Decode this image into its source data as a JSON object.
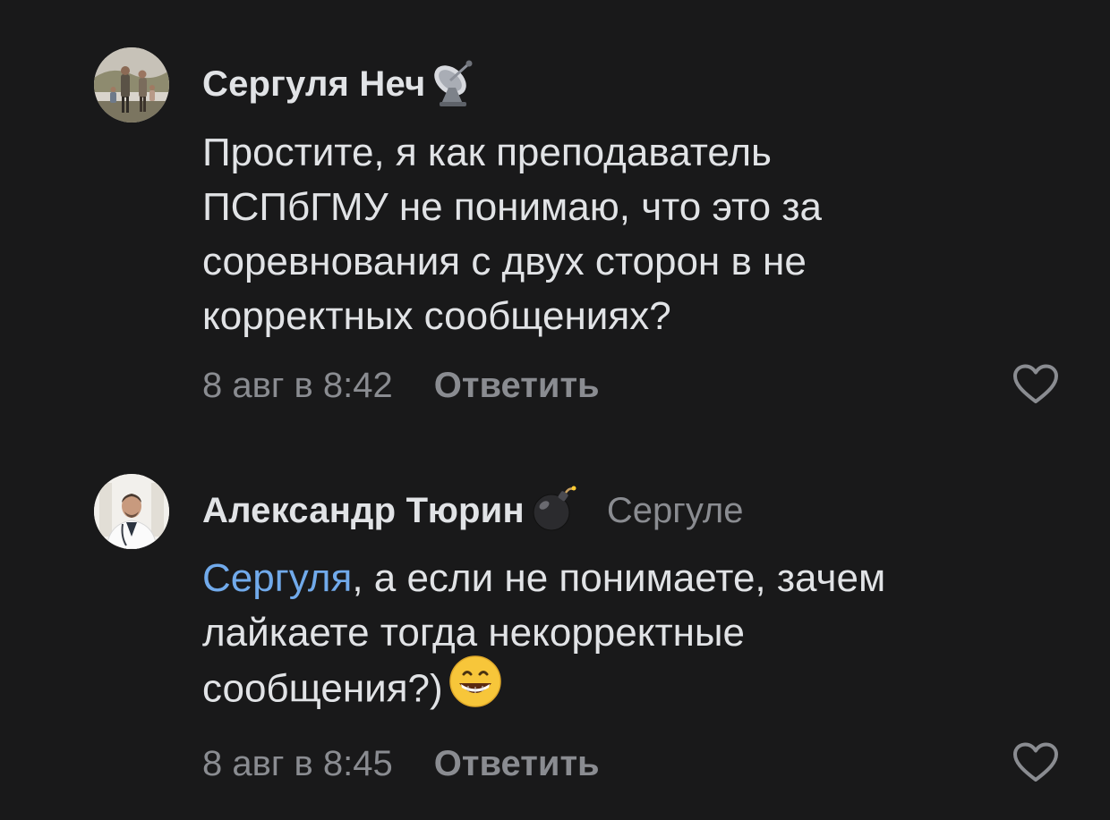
{
  "comments": [
    {
      "author": "Сергуля Неч",
      "author_badge": "satellite-dish-emoji",
      "reply_to": "",
      "mention": "",
      "lines": [
        "Простите, я как преподаватель",
        "ПСПбГМУ не понимаю, что это за",
        "соревнования с двух сторон в не",
        "корректных сообщениях?"
      ],
      "time": "8 авг в 8:42",
      "reply_label": "Ответить",
      "like_icon": "heart-outline-icon"
    },
    {
      "author": "Александр Тюрин",
      "author_badge": "bomb-emoji",
      "reply_to": "Сергуле",
      "mention": "Сергуля",
      "lines": [
        ", а если не понимаете, зачем",
        "лайкаете тогда некорректные",
        "сообщения?)"
      ],
      "trailing_emoji": "grinning-face-emoji",
      "time": "8 авг в 8:45",
      "reply_label": "Ответить",
      "like_icon": "heart-outline-icon"
    }
  ],
  "colors": {
    "background": "#19191a",
    "text_primary": "#e1e3e6",
    "text_secondary": "#8a8c91",
    "mention": "#71aaeb"
  }
}
